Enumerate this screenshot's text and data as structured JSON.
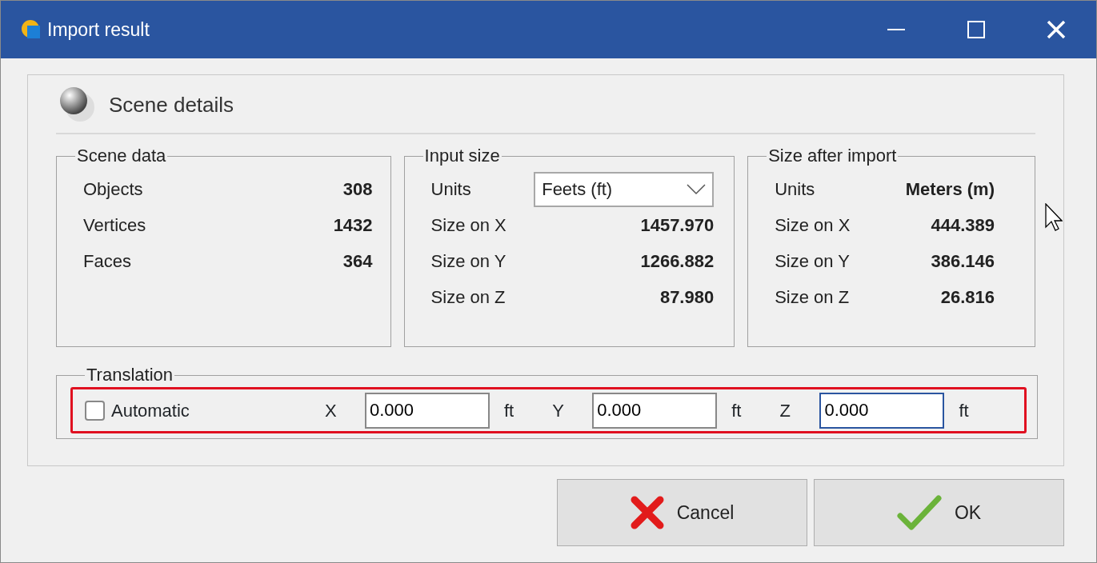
{
  "window": {
    "title": "Import result"
  },
  "header": {
    "title": "Scene details"
  },
  "scene_data": {
    "title": "Scene data",
    "rows": [
      {
        "label": "Objects",
        "value": "308"
      },
      {
        "label": "Vertices",
        "value": "1432"
      },
      {
        "label": "Faces",
        "value": "364"
      }
    ]
  },
  "input_size": {
    "title": "Input size",
    "units_label": "Units",
    "units_value": "Feets (ft)",
    "rows": [
      {
        "label": "Size on X",
        "value": "1457.970"
      },
      {
        "label": "Size on Y",
        "value": "1266.882"
      },
      {
        "label": "Size on Z",
        "value": "87.980"
      }
    ]
  },
  "size_after_import": {
    "title": "Size after import",
    "units_label": "Units",
    "units_value": "Meters (m)",
    "rows": [
      {
        "label": "Size on X",
        "value": "444.389"
      },
      {
        "label": "Size on Y",
        "value": "386.146"
      },
      {
        "label": "Size on Z",
        "value": "26.816"
      }
    ]
  },
  "translation": {
    "title": "Translation",
    "automatic": {
      "label": "Automatic",
      "checked": false
    },
    "axes": [
      {
        "label": "X",
        "value": "0.000",
        "unit": "ft",
        "focused": false
      },
      {
        "label": "Y",
        "value": "0.000",
        "unit": "ft",
        "focused": false
      },
      {
        "label": "Z",
        "value": "0.000",
        "unit": "ft",
        "focused": true
      }
    ]
  },
  "buttons": [
    {
      "label": "Cancel",
      "kind": "cancel"
    },
    {
      "label": "OK",
      "kind": "ok"
    }
  ]
}
